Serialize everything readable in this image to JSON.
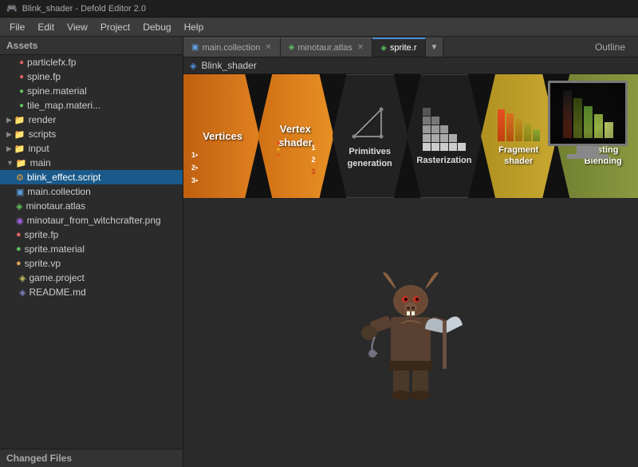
{
  "app": {
    "title": "Blink_shader - Defold Editor 2.0",
    "window_icon": "🎮"
  },
  "menubar": {
    "items": [
      "File",
      "Edit",
      "View",
      "Project",
      "Debug",
      "Help"
    ]
  },
  "tabs": [
    {
      "id": "main-collection",
      "label": "main.collection",
      "icon": "🔷",
      "active": false,
      "closable": true
    },
    {
      "id": "minotaur-atlas",
      "label": "minotaur.atlas",
      "icon": "🟢",
      "active": false,
      "closable": true
    },
    {
      "id": "sprite",
      "label": "sprite.r",
      "icon": "🟢",
      "active": false,
      "closable": false
    }
  ],
  "outline_label": "Outline",
  "editor_title": "Blink_shader",
  "pipeline": {
    "stages": [
      {
        "id": "vertices",
        "label": "Vertices",
        "sublabel": "",
        "type": "orange-first",
        "has_dots": true,
        "dots": [
          "1",
          "2",
          "3"
        ]
      },
      {
        "id": "vertex-shader",
        "label": "Vertex",
        "sublabel": "shader",
        "type": "orange",
        "has_dots": true,
        "dots": [
          "1",
          "2",
          "3"
        ]
      },
      {
        "id": "primitives",
        "label": "Primitives",
        "sublabel": "generation",
        "type": "dark",
        "has_graphic": "triangle"
      },
      {
        "id": "rasterization",
        "label": "Rasterization",
        "sublabel": "",
        "type": "dark",
        "has_graphic": "grid"
      },
      {
        "id": "fragment",
        "label": "Fragment",
        "sublabel": "shader",
        "type": "yellow",
        "has_graphic": "pixel-bars-warm"
      },
      {
        "id": "testing",
        "label": "Testing",
        "sublabel": "Blending",
        "type": "green",
        "has_graphic": "pixel-bars-cool"
      }
    ]
  },
  "sidebar": {
    "assets_label": "Assets",
    "tree": [
      {
        "id": "particlefx",
        "label": "particlefx.fp",
        "level": 1,
        "icon": "🔴",
        "type": "file"
      },
      {
        "id": "spine-fp",
        "label": "spine.fp",
        "level": 1,
        "icon": "🔴",
        "type": "file"
      },
      {
        "id": "spine-material",
        "label": "spine.material",
        "level": 1,
        "icon": "🟢",
        "type": "file"
      },
      {
        "id": "tile-map",
        "label": "tile_map.materi...",
        "level": 1,
        "icon": "🟢",
        "type": "file"
      },
      {
        "id": "render-folder",
        "label": "render",
        "level": 1,
        "icon": "📁",
        "type": "folder",
        "collapsed": true
      },
      {
        "id": "scripts-folder",
        "label": "scripts",
        "level": 1,
        "icon": "📁",
        "type": "folder",
        "collapsed": true
      },
      {
        "id": "input-folder",
        "label": "input",
        "level": 1,
        "icon": "📁",
        "type": "folder",
        "collapsed": true
      },
      {
        "id": "main-folder",
        "label": "main",
        "level": 1,
        "icon": "📁",
        "type": "folder",
        "collapsed": false
      },
      {
        "id": "blink-script",
        "label": "blink_effect.script",
        "level": 2,
        "icon": "⚙️",
        "type": "script",
        "active": true
      },
      {
        "id": "main-collection",
        "label": "main.collection",
        "level": 2,
        "icon": "🔷",
        "type": "collection"
      },
      {
        "id": "minotaur-atlas",
        "label": "minotaur.atlas",
        "level": 2,
        "icon": "🟢",
        "type": "atlas"
      },
      {
        "id": "minotaur-png",
        "label": "minotaur_from_witchcrafter.png",
        "level": 2,
        "icon": "🟣",
        "type": "png"
      },
      {
        "id": "sprite-fp",
        "label": "sprite.fp",
        "level": 2,
        "icon": "🔴",
        "type": "fp"
      },
      {
        "id": "sprite-material",
        "label": "sprite.material",
        "level": 2,
        "icon": "🟢",
        "type": "material"
      },
      {
        "id": "sprite-vp",
        "label": "sprite.vp",
        "level": 2,
        "icon": "🟡",
        "type": "vp"
      },
      {
        "id": "game-project",
        "label": "game.project",
        "level": 1,
        "icon": "🟡",
        "type": "project"
      },
      {
        "id": "readme",
        "label": "README.md",
        "level": 1,
        "icon": "🟦",
        "type": "readme"
      }
    ],
    "changed_files_label": "Changed Files"
  }
}
